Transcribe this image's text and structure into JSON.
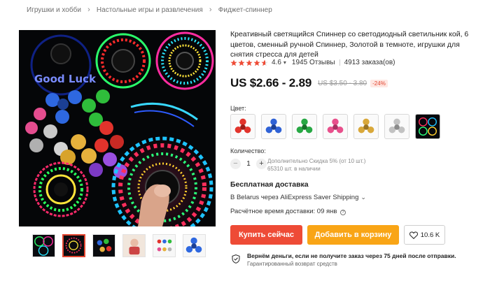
{
  "breadcrumbs": [
    "Игрушки и хобби",
    "Настольные игры и развлечения",
    "Фиджет-спиннер"
  ],
  "product": {
    "title": "Креативный светящийся Спиннер со светодиодный светильник кой, 6 цветов, сменный ручной Спиннер, Золотой в темноте, игрушки для снятия стресса для детей",
    "rating": "4.6",
    "rating_caret": "▾",
    "reviews": "1945 Отзывы",
    "orders": "4913 заказа(ов)",
    "price": "US $2.66 - 2.89",
    "old_price": "US $3.50 - 3.80",
    "discount": "-24%"
  },
  "image_text": {
    "good_luck": "Good Luck"
  },
  "color_section": {
    "label": "Цвет:",
    "swatches": [
      {
        "icon": "red-spinner-icon",
        "color": "#e2342c"
      },
      {
        "icon": "blue-spinner-icon",
        "color": "#2f62d6"
      },
      {
        "icon": "green-spinner-icon",
        "color": "#27a844"
      },
      {
        "icon": "pink-spinner-icon",
        "color": "#e8508c"
      },
      {
        "icon": "gold-spinner-icon",
        "color": "#d9a83a"
      },
      {
        "icon": "silver-spinner-icon",
        "color": "#b5b5b5"
      },
      {
        "icon": "led-spinner-icon",
        "color": "#1ec3ff"
      }
    ]
  },
  "quantity": {
    "label": "Количество:",
    "minus": "−",
    "value": "1",
    "plus": "+",
    "discount_info": "Дополнительно Скидка 5% (от 10 шт.)",
    "stock": "65310 шт. в наличии"
  },
  "shipping": {
    "free": "Бесплатная доставка",
    "method": "В Belarus через AliExpress Saver Shipping",
    "chevron": "⌄",
    "eta": "Расчётное время доставки: 09 янв",
    "help": "?"
  },
  "actions": {
    "buy": "Купить сейчас",
    "cart": "Добавить в корзину",
    "wishlist_count": "10.6 K"
  },
  "guarantee": {
    "line1": "Вернём деньги, если не получите заказ через 75 дней после отправки.",
    "line2": "Гарантированный возврат средств"
  },
  "colors": {
    "accent": "#ee4b36",
    "cart": "#f9a516",
    "star": "#ee4b36"
  }
}
